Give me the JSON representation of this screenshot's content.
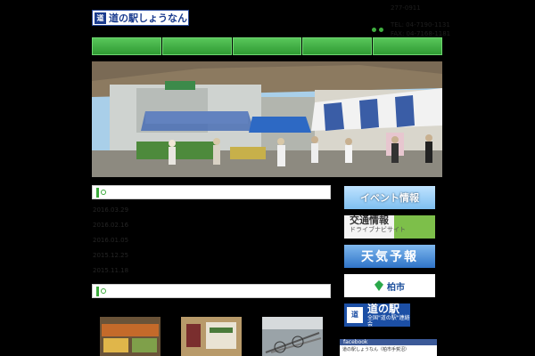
{
  "header": {
    "logo_mark": "道",
    "logo_text": "道の駅しょうなん",
    "zip": "277-0911",
    "tel": "TEL: 04-7190-1131",
    "fax": "FAX: 04-7168-1181"
  },
  "nav": {
    "items": [
      "",
      "",
      "",
      "",
      ""
    ]
  },
  "news": {
    "items": [
      {
        "date": "2016.03.29"
      },
      {
        "date": "2016.02.16"
      },
      {
        "date": "2016.01.05"
      },
      {
        "date": "2015.12.25"
      },
      {
        "date": "2015.11.18"
      }
    ]
  },
  "banners": {
    "event": "イベント情報",
    "traffic_title": "交通情報",
    "traffic_sub": "ドライブナビサイト",
    "weather": "天気予報",
    "city": "柏市",
    "michi_badge": "道",
    "michi_title": "道の駅",
    "michi_sub": "全国\"道の駅\"連絡会"
  },
  "facebook": {
    "head": "facebook",
    "body": "道の駅しょうなん（柏市手賀沼）"
  },
  "colors": {
    "nav_green": "#3fae3f",
    "background": "#000000",
    "section_accent": "#3caa3c"
  }
}
